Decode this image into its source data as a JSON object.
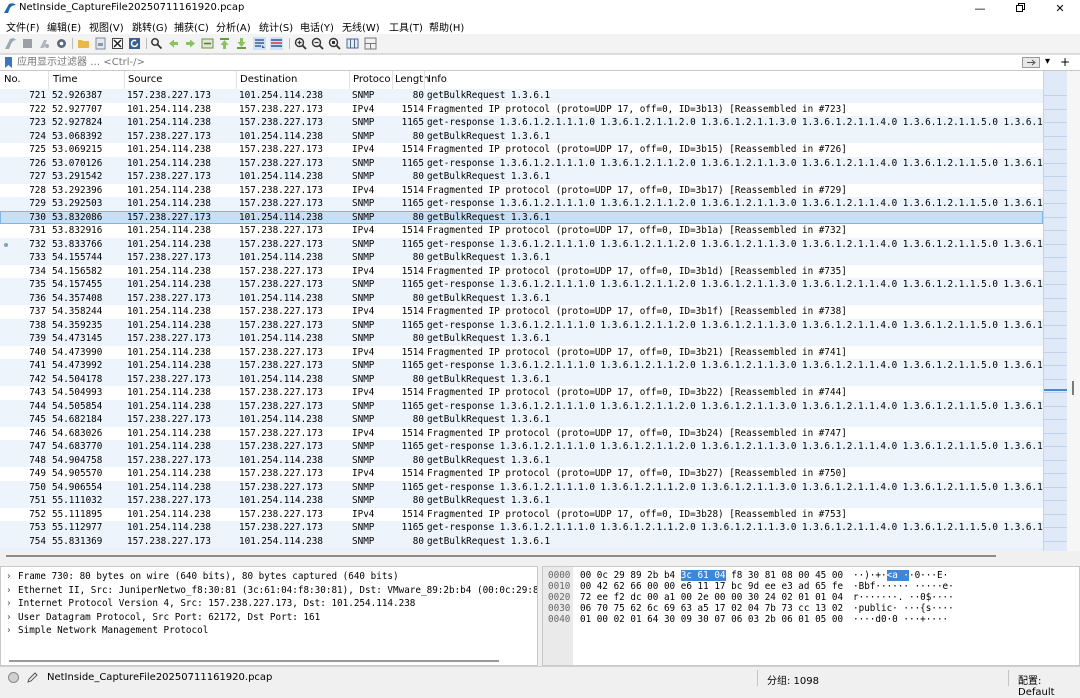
{
  "window": {
    "title": "NetInside_CaptureFile20250711161920.pcap"
  },
  "menu": [
    "文件(F)",
    "编辑(E)",
    "视图(V)",
    "跳转(G)",
    "捕获(C)",
    "分析(A)",
    "统计(S)",
    "电话(Y)",
    "无线(W)",
    "工具(T)",
    "帮助(H)"
  ],
  "toolbar": {
    "icons": [
      "shark-fin-start-icon",
      "stop-icon",
      "restart-icon",
      "options-gear-icon",
      "open-folder-icon",
      "save-file-icon",
      "close-file-icon",
      "reload-icon",
      "find-icon",
      "go-back-icon",
      "go-forward-icon",
      "go-to-packet-icon",
      "go-first-icon",
      "go-last-icon",
      "autoscroll-icon",
      "colorize-icon",
      "zoom-in-icon",
      "zoom-out-icon",
      "zoom-normal-icon",
      "resize-columns-icon",
      "layout-icon"
    ]
  },
  "filter": {
    "placeholder": "应用显示过滤器 … <Ctrl-/>"
  },
  "columns": {
    "no": "No.",
    "time": "Time",
    "source": "Source",
    "destination": "Destination",
    "protocol": "Protoco",
    "length": "Length",
    "info": "Info"
  },
  "packets": [
    {
      "no": "721",
      "time": "52.926387",
      "src": "157.238.227.173",
      "dst": "101.254.114.238",
      "proto": "SNMP",
      "len": "80",
      "info": "getBulkRequest 1.3.6.1"
    },
    {
      "no": "722",
      "time": "52.927707",
      "src": "101.254.114.238",
      "dst": "157.238.227.173",
      "proto": "IPv4",
      "len": "1514",
      "info": "Fragmented IP protocol (proto=UDP 17, off=0, ID=3b13) [Reassembled in #723]"
    },
    {
      "no": "723",
      "time": "52.927824",
      "src": "101.254.114.238",
      "dst": "157.238.227.173",
      "proto": "SNMP",
      "len": "1165",
      "info": "get-response 1.3.6.1.2.1.1.1.0 1.3.6.1.2.1.1.2.0 1.3.6.1.2.1.1.3.0 1.3.6.1.2.1.1.4.0 1.3.6.1.2.1.1.5.0 1.3.6.1.2.1."
    },
    {
      "no": "724",
      "time": "53.068392",
      "src": "157.238.227.173",
      "dst": "101.254.114.238",
      "proto": "SNMP",
      "len": "80",
      "info": "getBulkRequest 1.3.6.1"
    },
    {
      "no": "725",
      "time": "53.069215",
      "src": "101.254.114.238",
      "dst": "157.238.227.173",
      "proto": "IPv4",
      "len": "1514",
      "info": "Fragmented IP protocol (proto=UDP 17, off=0, ID=3b15) [Reassembled in #726]"
    },
    {
      "no": "726",
      "time": "53.070126",
      "src": "101.254.114.238",
      "dst": "157.238.227.173",
      "proto": "SNMP",
      "len": "1165",
      "info": "get-response 1.3.6.1.2.1.1.1.0 1.3.6.1.2.1.1.2.0 1.3.6.1.2.1.1.3.0 1.3.6.1.2.1.1.4.0 1.3.6.1.2.1.1.5.0 1.3.6.1.2.1."
    },
    {
      "no": "727",
      "time": "53.291542",
      "src": "157.238.227.173",
      "dst": "101.254.114.238",
      "proto": "SNMP",
      "len": "80",
      "info": "getBulkRequest 1.3.6.1"
    },
    {
      "no": "728",
      "time": "53.292396",
      "src": "101.254.114.238",
      "dst": "157.238.227.173",
      "proto": "IPv4",
      "len": "1514",
      "info": "Fragmented IP protocol (proto=UDP 17, off=0, ID=3b17) [Reassembled in #729]"
    },
    {
      "no": "729",
      "time": "53.292503",
      "src": "101.254.114.238",
      "dst": "157.238.227.173",
      "proto": "SNMP",
      "len": "1165",
      "info": "get-response 1.3.6.1.2.1.1.1.0 1.3.6.1.2.1.1.2.0 1.3.6.1.2.1.1.3.0 1.3.6.1.2.1.1.4.0 1.3.6.1.2.1.1.5.0 1.3.6.1.2.1."
    },
    {
      "no": "730",
      "time": "53.832086",
      "src": "157.238.227.173",
      "dst": "101.254.114.238",
      "proto": "SNMP",
      "len": "80",
      "info": "getBulkRequest 1.3.6.1"
    },
    {
      "no": "731",
      "time": "53.832916",
      "src": "101.254.114.238",
      "dst": "157.238.227.173",
      "proto": "IPv4",
      "len": "1514",
      "info": "Fragmented IP protocol (proto=UDP 17, off=0, ID=3b1a) [Reassembled in #732]"
    },
    {
      "no": "732",
      "time": "53.833766",
      "src": "101.254.114.238",
      "dst": "157.238.227.173",
      "proto": "SNMP",
      "len": "1165",
      "info": "get-response 1.3.6.1.2.1.1.1.0 1.3.6.1.2.1.1.2.0 1.3.6.1.2.1.1.3.0 1.3.6.1.2.1.1.4.0 1.3.6.1.2.1.1.5.0 1.3.6.1.2.1."
    },
    {
      "no": "733",
      "time": "54.155744",
      "src": "157.238.227.173",
      "dst": "101.254.114.238",
      "proto": "SNMP",
      "len": "80",
      "info": "getBulkRequest 1.3.6.1"
    },
    {
      "no": "734",
      "time": "54.156582",
      "src": "101.254.114.238",
      "dst": "157.238.227.173",
      "proto": "IPv4",
      "len": "1514",
      "info": "Fragmented IP protocol (proto=UDP 17, off=0, ID=3b1d) [Reassembled in #735]"
    },
    {
      "no": "735",
      "time": "54.157455",
      "src": "101.254.114.238",
      "dst": "157.238.227.173",
      "proto": "SNMP",
      "len": "1165",
      "info": "get-response 1.3.6.1.2.1.1.1.0 1.3.6.1.2.1.1.2.0 1.3.6.1.2.1.1.3.0 1.3.6.1.2.1.1.4.0 1.3.6.1.2.1.1.5.0 1.3.6.1.2.1."
    },
    {
      "no": "736",
      "time": "54.357408",
      "src": "157.238.227.173",
      "dst": "101.254.114.238",
      "proto": "SNMP",
      "len": "80",
      "info": "getBulkRequest 1.3.6.1"
    },
    {
      "no": "737",
      "time": "54.358244",
      "src": "101.254.114.238",
      "dst": "157.238.227.173",
      "proto": "IPv4",
      "len": "1514",
      "info": "Fragmented IP protocol (proto=UDP 17, off=0, ID=3b1f) [Reassembled in #738]"
    },
    {
      "no": "738",
      "time": "54.359235",
      "src": "101.254.114.238",
      "dst": "157.238.227.173",
      "proto": "SNMP",
      "len": "1165",
      "info": "get-response 1.3.6.1.2.1.1.1.0 1.3.6.1.2.1.1.2.0 1.3.6.1.2.1.1.3.0 1.3.6.1.2.1.1.4.0 1.3.6.1.2.1.1.5.0 1.3.6.1.2.1."
    },
    {
      "no": "739",
      "time": "54.473145",
      "src": "157.238.227.173",
      "dst": "101.254.114.238",
      "proto": "SNMP",
      "len": "80",
      "info": "getBulkRequest 1.3.6.1"
    },
    {
      "no": "740",
      "time": "54.473990",
      "src": "101.254.114.238",
      "dst": "157.238.227.173",
      "proto": "IPv4",
      "len": "1514",
      "info": "Fragmented IP protocol (proto=UDP 17, off=0, ID=3b21) [Reassembled in #741]"
    },
    {
      "no": "741",
      "time": "54.473992",
      "src": "101.254.114.238",
      "dst": "157.238.227.173",
      "proto": "SNMP",
      "len": "1165",
      "info": "get-response 1.3.6.1.2.1.1.1.0 1.3.6.1.2.1.1.2.0 1.3.6.1.2.1.1.3.0 1.3.6.1.2.1.1.4.0 1.3.6.1.2.1.1.5.0 1.3.6.1.2.1."
    },
    {
      "no": "742",
      "time": "54.504178",
      "src": "157.238.227.173",
      "dst": "101.254.114.238",
      "proto": "SNMP",
      "len": "80",
      "info": "getBulkRequest 1.3.6.1"
    },
    {
      "no": "743",
      "time": "54.504993",
      "src": "101.254.114.238",
      "dst": "157.238.227.173",
      "proto": "IPv4",
      "len": "1514",
      "info": "Fragmented IP protocol (proto=UDP 17, off=0, ID=3b22) [Reassembled in #744]"
    },
    {
      "no": "744",
      "time": "54.505854",
      "src": "101.254.114.238",
      "dst": "157.238.227.173",
      "proto": "SNMP",
      "len": "1165",
      "info": "get-response 1.3.6.1.2.1.1.1.0 1.3.6.1.2.1.1.2.0 1.3.6.1.2.1.1.3.0 1.3.6.1.2.1.1.4.0 1.3.6.1.2.1.1.5.0 1.3.6.1.2.1."
    },
    {
      "no": "745",
      "time": "54.682184",
      "src": "157.238.227.173",
      "dst": "101.254.114.238",
      "proto": "SNMP",
      "len": "80",
      "info": "getBulkRequest 1.3.6.1"
    },
    {
      "no": "746",
      "time": "54.683026",
      "src": "101.254.114.238",
      "dst": "157.238.227.173",
      "proto": "IPv4",
      "len": "1514",
      "info": "Fragmented IP protocol (proto=UDP 17, off=0, ID=3b24) [Reassembled in #747]"
    },
    {
      "no": "747",
      "time": "54.683770",
      "src": "101.254.114.238",
      "dst": "157.238.227.173",
      "proto": "SNMP",
      "len": "1165",
      "info": "get-response 1.3.6.1.2.1.1.1.0 1.3.6.1.2.1.1.2.0 1.3.6.1.2.1.1.3.0 1.3.6.1.2.1.1.4.0 1.3.6.1.2.1.1.5.0 1.3.6.1.2.1."
    },
    {
      "no": "748",
      "time": "54.904758",
      "src": "157.238.227.173",
      "dst": "101.254.114.238",
      "proto": "SNMP",
      "len": "80",
      "info": "getBulkRequest 1.3.6.1"
    },
    {
      "no": "749",
      "time": "54.905570",
      "src": "101.254.114.238",
      "dst": "157.238.227.173",
      "proto": "IPv4",
      "len": "1514",
      "info": "Fragmented IP protocol (proto=UDP 17, off=0, ID=3b27) [Reassembled in #750]"
    },
    {
      "no": "750",
      "time": "54.906554",
      "src": "101.254.114.238",
      "dst": "157.238.227.173",
      "proto": "SNMP",
      "len": "1165",
      "info": "get-response 1.3.6.1.2.1.1.1.0 1.3.6.1.2.1.1.2.0 1.3.6.1.2.1.1.3.0 1.3.6.1.2.1.1.4.0 1.3.6.1.2.1.1.5.0 1.3.6.1.2.1."
    },
    {
      "no": "751",
      "time": "55.111032",
      "src": "157.238.227.173",
      "dst": "101.254.114.238",
      "proto": "SNMP",
      "len": "80",
      "info": "getBulkRequest 1.3.6.1"
    },
    {
      "no": "752",
      "time": "55.111895",
      "src": "101.254.114.238",
      "dst": "157.238.227.173",
      "proto": "IPv4",
      "len": "1514",
      "info": "Fragmented IP protocol (proto=UDP 17, off=0, ID=3b28) [Reassembled in #753]"
    },
    {
      "no": "753",
      "time": "55.112977",
      "src": "101.254.114.238",
      "dst": "157.238.227.173",
      "proto": "SNMP",
      "len": "1165",
      "info": "get-response 1.3.6.1.2.1.1.1.0 1.3.6.1.2.1.1.2.0 1.3.6.1.2.1.1.3.0 1.3.6.1.2.1.1.4.0 1.3.6.1.2.1.1.5.0 1.3.6.1.2.1."
    },
    {
      "no": "754",
      "time": "55.831369",
      "src": "157.238.227.173",
      "dst": "101.254.114.238",
      "proto": "SNMP",
      "len": "80",
      "info": "getBulkRequest 1.3.6.1"
    }
  ],
  "selected_packet": "730",
  "details": [
    "Frame 730: 80 bytes on wire (640 bits), 80 bytes captured (640 bits)",
    "Ethernet II, Src: JuniperNetwo_f8:30:81 (3c:61:04:f8:30:81), Dst: VMware_89:2b:b4 (00:0c:29:89:2b",
    "Internet Protocol Version 4, Src: 157.238.227.173, Dst: 101.254.114.238",
    "User Datagram Protocol, Src Port: 62172, Dst Port: 161",
    "Simple Network Management Protocol"
  ],
  "bytes": [
    {
      "offset": "0000",
      "hex_pre": "00 0c 29 89 2b b4 ",
      "hex_hl": "3c 61  04",
      "hex_post": " f8 30 81 08 00 45 00",
      "ascii_pre": "··)·+·",
      "ascii_hl": "<a ·",
      "ascii_post": "·0···E·"
    },
    {
      "offset": "0010",
      "hex_pre": "00 42 62 66 00 00 e6 11  17 bc 9d ee e3 ad 65 fe",
      "hex_hl": "",
      "hex_post": "",
      "ascii_pre": "·Bbf······ ·····e·",
      "ascii_hl": "",
      "ascii_post": ""
    },
    {
      "offset": "0020",
      "hex_pre": "72 ee f2 dc 00 a1 00 2e  00 00 30 24 02 01 01 04",
      "hex_hl": "",
      "hex_post": "",
      "ascii_pre": "r·······. ··0$····",
      "ascii_hl": "",
      "ascii_post": ""
    },
    {
      "offset": "0030",
      "hex_pre": "06 70 75 62 6c 69 63 a5  17 02 04 7b 73 cc 13 02",
      "hex_hl": "",
      "hex_post": "",
      "ascii_pre": "·public· ···{s····",
      "ascii_hl": "",
      "ascii_post": ""
    },
    {
      "offset": "0040",
      "hex_pre": "01 00 02 01 64 30 09 30  07 06 03 2b 06 01 05 00",
      "hex_hl": "",
      "hex_post": "",
      "ascii_pre": "····d0·0 ···+····",
      "ascii_hl": "",
      "ascii_post": ""
    }
  ],
  "status": {
    "file": "NetInside_CaptureFile20250711161920.pcap",
    "packets": "分组: 1098",
    "profile": "配置: Default"
  },
  "colors": {
    "snmp_row": "#eef4fc",
    "ipv4_row": "#ffffff",
    "selected_row": "#c6e0f7",
    "byte_highlight": "#3f86d6"
  }
}
